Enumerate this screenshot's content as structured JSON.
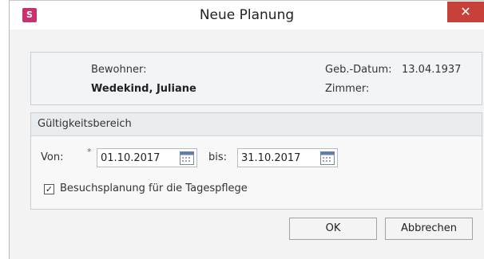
{
  "dialog": {
    "app_icon_letter": "S",
    "title": "Neue Planung",
    "close_glyph": "✕"
  },
  "resident": {
    "label": "Bewohner:",
    "name": "Wedekind, Juliane",
    "birth_label": "Geb.-Datum:",
    "birth_date": "13.04.1937",
    "room_label": "Zimmer:"
  },
  "validity": {
    "title": "Gültigkeitsbereich",
    "from_label": "Von:",
    "required_marker": "*",
    "from_value": "01.10.2017",
    "to_label": "bis:",
    "to_value": "31.10.2017",
    "checkbox_label": "Besuchsplanung für die Tagespflege",
    "checkbox_checked": true,
    "check_glyph": "✓"
  },
  "buttons": {
    "ok": "OK",
    "cancel": "Abbrechen"
  },
  "icons": [
    "app-icon",
    "close-icon",
    "calendar-icon",
    "checkbox-check-icon"
  ],
  "colors": {
    "close": "#c7403a",
    "app_icon": "#c8336f"
  }
}
